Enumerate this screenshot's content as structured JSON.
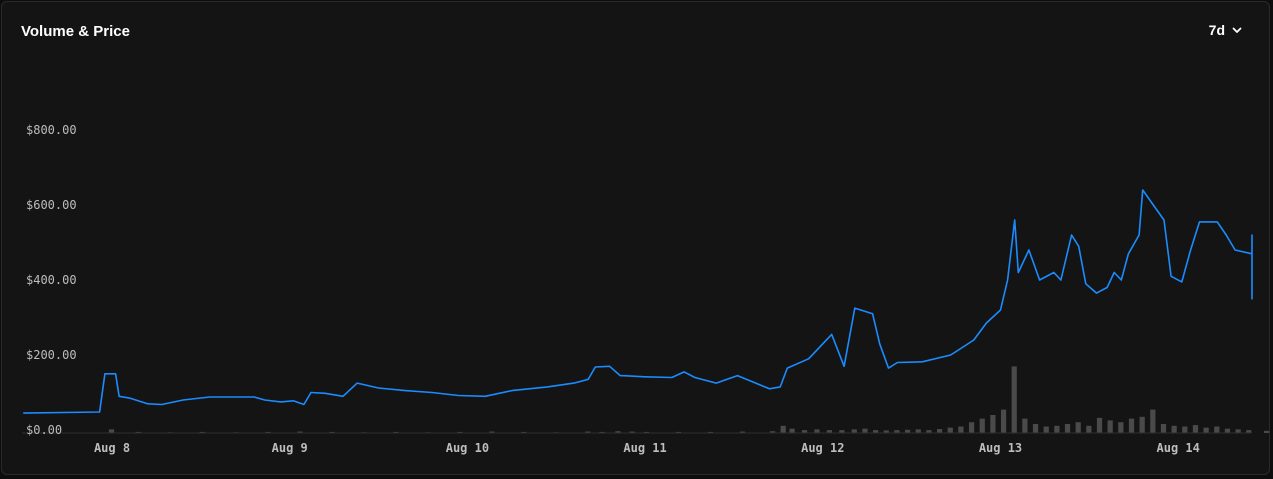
{
  "header": {
    "title": "Volume & Price",
    "range_label": "7d"
  },
  "colors": {
    "price_line": "#1a8cff",
    "volume_bar": "#4a4a4a",
    "background": "#141414"
  },
  "chart_data": {
    "type": "line",
    "title": "Volume & Price",
    "xlabel": "",
    "ylabel": "",
    "x_ticks": [
      {
        "label": "Aug 8",
        "x": 1.0
      },
      {
        "label": "Aug 9",
        "x": 2.0
      },
      {
        "label": "Aug 10",
        "x": 3.0
      },
      {
        "label": "Aug 11",
        "x": 4.0
      },
      {
        "label": "Aug 12",
        "x": 5.0
      },
      {
        "label": "Aug 13",
        "x": 6.0
      },
      {
        "label": "Aug 14",
        "x": 7.0
      }
    ],
    "xlim": [
      0.5,
      7.45
    ],
    "ylim": [
      0,
      1000
    ],
    "y_ticks": [
      {
        "label": "$0.00",
        "value": 0
      },
      {
        "label": "$200.00",
        "value": 200
      },
      {
        "label": "$400.00",
        "value": 400
      },
      {
        "label": "$600.00",
        "value": 600
      },
      {
        "label": "$800.00",
        "value": 800
      }
    ],
    "grid": false,
    "series": [
      {
        "values": [
          [
            0.5,
            45
          ],
          [
            0.93,
            48
          ],
          [
            0.96,
            150
          ],
          [
            1.02,
            150
          ],
          [
            1.04,
            90
          ],
          [
            1.1,
            85
          ],
          [
            1.2,
            70
          ],
          [
            1.28,
            68
          ],
          [
            1.4,
            80
          ],
          [
            1.55,
            88
          ],
          [
            1.8,
            88
          ],
          [
            1.86,
            80
          ],
          [
            1.95,
            75
          ],
          [
            2.02,
            78
          ],
          [
            2.08,
            68
          ],
          [
            2.12,
            100
          ],
          [
            2.2,
            98
          ],
          [
            2.3,
            90
          ],
          [
            2.38,
            125
          ],
          [
            2.5,
            112
          ],
          [
            2.65,
            105
          ],
          [
            2.8,
            100
          ],
          [
            2.95,
            92
          ],
          [
            3.1,
            90
          ],
          [
            3.25,
            105
          ],
          [
            3.45,
            115
          ],
          [
            3.6,
            125
          ],
          [
            3.68,
            135
          ],
          [
            3.72,
            168
          ],
          [
            3.8,
            170
          ],
          [
            3.86,
            145
          ],
          [
            4.0,
            142
          ],
          [
            4.15,
            140
          ],
          [
            4.22,
            155
          ],
          [
            4.28,
            140
          ],
          [
            4.4,
            125
          ],
          [
            4.52,
            145
          ],
          [
            4.7,
            110
          ],
          [
            4.76,
            115
          ],
          [
            4.8,
            165
          ],
          [
            4.92,
            190
          ],
          [
            5.05,
            255
          ],
          [
            5.12,
            170
          ],
          [
            5.18,
            325
          ],
          [
            5.28,
            310
          ],
          [
            5.32,
            230
          ],
          [
            5.37,
            165
          ],
          [
            5.42,
            180
          ],
          [
            5.56,
            182
          ],
          [
            5.72,
            200
          ],
          [
            5.85,
            240
          ],
          [
            5.92,
            285
          ],
          [
            6.0,
            320
          ],
          [
            6.04,
            400
          ],
          [
            6.08,
            560
          ],
          [
            6.1,
            420
          ],
          [
            6.16,
            480
          ],
          [
            6.22,
            400
          ],
          [
            6.3,
            420
          ],
          [
            6.34,
            400
          ],
          [
            6.4,
            520
          ],
          [
            6.44,
            490
          ],
          [
            6.48,
            390
          ],
          [
            6.54,
            365
          ],
          [
            6.6,
            380
          ],
          [
            6.64,
            420
          ],
          [
            6.68,
            400
          ],
          [
            6.72,
            470
          ],
          [
            6.78,
            520
          ],
          [
            6.8,
            640
          ],
          [
            6.86,
            600
          ],
          [
            6.92,
            560
          ],
          [
            6.96,
            410
          ],
          [
            7.02,
            395
          ],
          [
            7.07,
            480
          ],
          [
            7.12,
            555
          ],
          [
            7.22,
            555
          ],
          [
            7.27,
            520
          ],
          [
            7.32,
            480
          ],
          [
            7.46,
            470
          ],
          [
            7.5,
            520
          ],
          [
            7.6,
            500
          ],
          [
            7.64,
            430
          ],
          [
            7.7,
            375
          ],
          [
            7.8,
            350
          ],
          [
            7.85,
            365
          ],
          [
            7.96,
            375
          ],
          [
            8.02,
            405
          ],
          [
            8.06,
            420
          ],
          [
            8.16,
            410
          ],
          [
            8.24,
            430
          ],
          [
            8.32,
            460
          ],
          [
            8.36,
            475
          ]
        ]
      }
    ],
    "volume": {
      "bar_width": 0.035,
      "bars": [
        [
          1.0,
          10
        ],
        [
          1.15,
          3
        ],
        [
          1.33,
          2
        ],
        [
          1.51,
          3
        ],
        [
          1.7,
          2
        ],
        [
          1.88,
          3
        ],
        [
          2.06,
          4
        ],
        [
          2.24,
          3
        ],
        [
          2.42,
          2
        ],
        [
          2.6,
          3
        ],
        [
          2.78,
          2
        ],
        [
          2.96,
          3
        ],
        [
          3.14,
          4
        ],
        [
          3.32,
          3
        ],
        [
          3.5,
          2
        ],
        [
          3.68,
          4
        ],
        [
          3.76,
          3
        ],
        [
          3.85,
          5
        ],
        [
          3.93,
          4
        ],
        [
          4.01,
          3
        ],
        [
          4.19,
          3
        ],
        [
          4.37,
          3
        ],
        [
          4.55,
          4
        ],
        [
          4.72,
          5
        ],
        [
          4.78,
          20
        ],
        [
          4.83,
          12
        ],
        [
          4.9,
          8
        ],
        [
          4.97,
          10
        ],
        [
          5.04,
          8
        ],
        [
          5.11,
          8
        ],
        [
          5.18,
          10
        ],
        [
          5.24,
          12
        ],
        [
          5.3,
          8
        ],
        [
          5.36,
          7
        ],
        [
          5.42,
          8
        ],
        [
          5.48,
          9
        ],
        [
          5.54,
          10
        ],
        [
          5.6,
          8
        ],
        [
          5.66,
          11
        ],
        [
          5.72,
          15
        ],
        [
          5.78,
          18
        ],
        [
          5.84,
          30
        ],
        [
          5.9,
          40
        ],
        [
          5.96,
          50
        ],
        [
          6.02,
          65
        ],
        [
          6.08,
          185
        ],
        [
          6.14,
          40
        ],
        [
          6.2,
          25
        ],
        [
          6.26,
          18
        ],
        [
          6.32,
          20
        ],
        [
          6.38,
          25
        ],
        [
          6.44,
          30
        ],
        [
          6.5,
          20
        ],
        [
          6.56,
          42
        ],
        [
          6.62,
          35
        ],
        [
          6.68,
          30
        ],
        [
          6.74,
          40
        ],
        [
          6.8,
          45
        ],
        [
          6.86,
          65
        ],
        [
          6.92,
          25
        ],
        [
          6.98,
          20
        ],
        [
          7.04,
          18
        ],
        [
          7.1,
          22
        ],
        [
          7.16,
          15
        ],
        [
          7.22,
          18
        ],
        [
          7.28,
          12
        ],
        [
          7.34,
          10
        ],
        [
          7.4,
          8
        ],
        [
          7.5,
          6
        ],
        [
          7.6,
          7
        ],
        [
          7.7,
          6
        ],
        [
          7.8,
          5
        ],
        [
          7.9,
          6
        ],
        [
          8.0,
          5
        ],
        [
          8.1,
          7
        ],
        [
          8.2,
          10
        ],
        [
          8.3,
          6
        ]
      ]
    }
  }
}
